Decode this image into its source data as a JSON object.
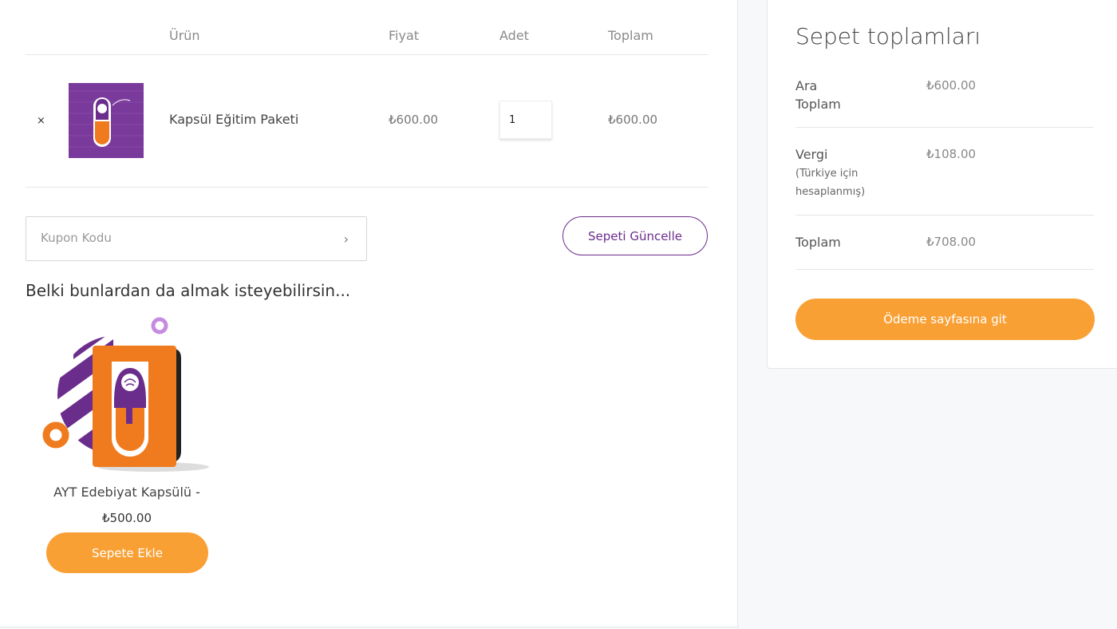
{
  "cart_table": {
    "headers": {
      "product": "Ürün",
      "price": "Fiyat",
      "quantity": "Adet",
      "total": "Toplam"
    },
    "items": [
      {
        "remove_label": "×",
        "name": "Kapsül Eğitim Paketi",
        "price": "₺600.00",
        "quantity": "1",
        "subtotal": "₺600.00"
      }
    ]
  },
  "coupon": {
    "placeholder": "Kupon Kodu",
    "submit_icon": "chevron-right-icon"
  },
  "update_cart_label": "Sepeti Güncelle",
  "cross_sells": {
    "title": "Belki bunlardan da almak isteyebilirsin...",
    "items": [
      {
        "name": "AYT Edebiyat Kapsülü -",
        "price": "₺500.00",
        "button_label": "Sepete Ekle"
      }
    ]
  },
  "cart_totals": {
    "title": "Sepet toplamları",
    "subtotal_label_1": "Ara",
    "subtotal_label_2": "Toplam",
    "subtotal_value": "₺600.00",
    "tax_label": "Vergi",
    "tax_note_1": "(Türkiye için",
    "tax_note_2": "hesaplanmış)",
    "tax_value": "₺108.00",
    "total_label": "Toplam",
    "total_value": "₺708.00",
    "checkout_label": "Ödeme sayfasına git"
  },
  "colors": {
    "brand_purple": "#6b2d8c",
    "accent_orange": "#f9a035"
  }
}
